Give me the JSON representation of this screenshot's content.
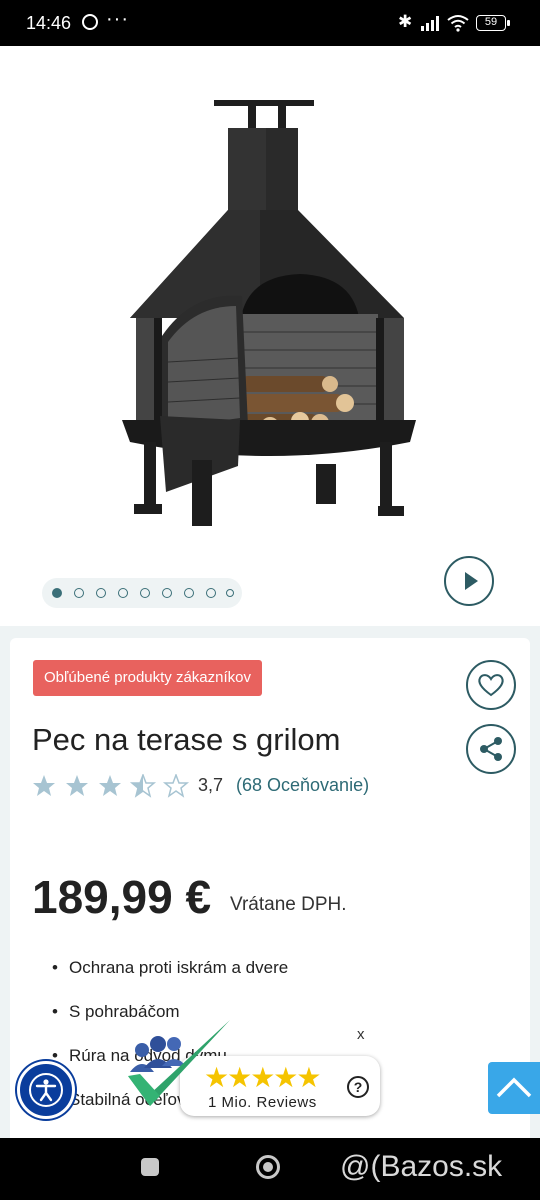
{
  "status_bar": {
    "time": "14:46",
    "more": "···",
    "bluetooth": "✱",
    "battery": "59"
  },
  "gallery": {
    "image_icon": "outdoor-fireplace-image",
    "dot_count": 9,
    "active_dot": 0,
    "play_icon": "play-icon"
  },
  "product": {
    "badge": "Obľúbené produkty zákazníkov",
    "title": "Pec na terase s grilom",
    "rating": 3.7,
    "rating_text": "3,7",
    "rating_max": 5,
    "rating_count": "(68 Oceňovanie)",
    "price": "189,99 €",
    "vat_note": "Vrátane DPH.",
    "features": [
      "Ochrana proti iskrám a dvere",
      "S pohrabáčom",
      "Rúra na odvod dymu",
      "Stabilná oceľová konštrukcia"
    ],
    "actions": {
      "wishlist_icon": "heart-icon",
      "share_icon": "share-icon"
    }
  },
  "trust_widget": {
    "stars": "★★★★★",
    "text": "1 Mio. Reviews",
    "help": "?",
    "close": "x"
  },
  "floating": {
    "accessibility_icon": "accessibility-icon",
    "scroll_top_icon": "chevron-up-icon"
  },
  "watermark": "@(Bazos.sk",
  "colors": {
    "accent": "#2d5b63",
    "badge": "#e8625e",
    "star": "#a7c4d2",
    "link": "#2d6a75",
    "trust_star": "#f5c400",
    "accessibility": "#0a3d9c",
    "scroll_top": "#39a7e8"
  }
}
